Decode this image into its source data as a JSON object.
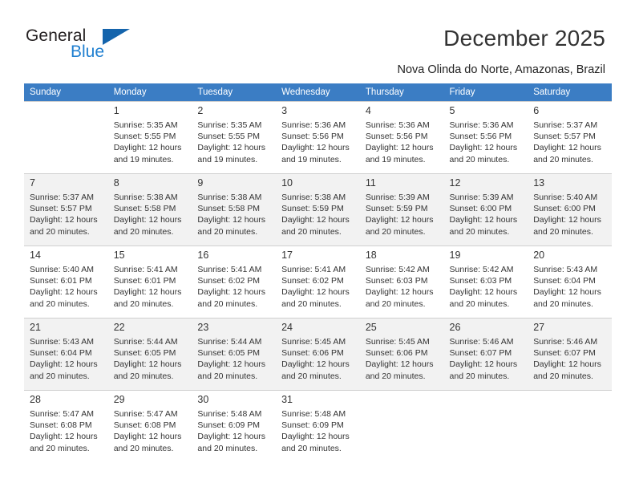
{
  "brand": {
    "name_part1": "General",
    "name_part2": "Blue",
    "accent_color": "#1f7fd0",
    "triangle_color": "#1464ac"
  },
  "header": {
    "title": "December 2025",
    "location": "Nova Olinda do Norte, Amazonas, Brazil"
  },
  "calendar": {
    "header_color": "#3b7dc4",
    "weekdays": [
      "Sunday",
      "Monday",
      "Tuesday",
      "Wednesday",
      "Thursday",
      "Friday",
      "Saturday"
    ],
    "weeks": [
      {
        "shaded": false,
        "days": [
          {
            "num": "",
            "sunrise": "",
            "sunset": "",
            "daylight1": "",
            "daylight2": ""
          },
          {
            "num": "1",
            "sunrise": "Sunrise: 5:35 AM",
            "sunset": "Sunset: 5:55 PM",
            "daylight1": "Daylight: 12 hours",
            "daylight2": "and 19 minutes."
          },
          {
            "num": "2",
            "sunrise": "Sunrise: 5:35 AM",
            "sunset": "Sunset: 5:55 PM",
            "daylight1": "Daylight: 12 hours",
            "daylight2": "and 19 minutes."
          },
          {
            "num": "3",
            "sunrise": "Sunrise: 5:36 AM",
            "sunset": "Sunset: 5:56 PM",
            "daylight1": "Daylight: 12 hours",
            "daylight2": "and 19 minutes."
          },
          {
            "num": "4",
            "sunrise": "Sunrise: 5:36 AM",
            "sunset": "Sunset: 5:56 PM",
            "daylight1": "Daylight: 12 hours",
            "daylight2": "and 19 minutes."
          },
          {
            "num": "5",
            "sunrise": "Sunrise: 5:36 AM",
            "sunset": "Sunset: 5:56 PM",
            "daylight1": "Daylight: 12 hours",
            "daylight2": "and 20 minutes."
          },
          {
            "num": "6",
            "sunrise": "Sunrise: 5:37 AM",
            "sunset": "Sunset: 5:57 PM",
            "daylight1": "Daylight: 12 hours",
            "daylight2": "and 20 minutes."
          }
        ]
      },
      {
        "shaded": true,
        "days": [
          {
            "num": "7",
            "sunrise": "Sunrise: 5:37 AM",
            "sunset": "Sunset: 5:57 PM",
            "daylight1": "Daylight: 12 hours",
            "daylight2": "and 20 minutes."
          },
          {
            "num": "8",
            "sunrise": "Sunrise: 5:38 AM",
            "sunset": "Sunset: 5:58 PM",
            "daylight1": "Daylight: 12 hours",
            "daylight2": "and 20 minutes."
          },
          {
            "num": "9",
            "sunrise": "Sunrise: 5:38 AM",
            "sunset": "Sunset: 5:58 PM",
            "daylight1": "Daylight: 12 hours",
            "daylight2": "and 20 minutes."
          },
          {
            "num": "10",
            "sunrise": "Sunrise: 5:38 AM",
            "sunset": "Sunset: 5:59 PM",
            "daylight1": "Daylight: 12 hours",
            "daylight2": "and 20 minutes."
          },
          {
            "num": "11",
            "sunrise": "Sunrise: 5:39 AM",
            "sunset": "Sunset: 5:59 PM",
            "daylight1": "Daylight: 12 hours",
            "daylight2": "and 20 minutes."
          },
          {
            "num": "12",
            "sunrise": "Sunrise: 5:39 AM",
            "sunset": "Sunset: 6:00 PM",
            "daylight1": "Daylight: 12 hours",
            "daylight2": "and 20 minutes."
          },
          {
            "num": "13",
            "sunrise": "Sunrise: 5:40 AM",
            "sunset": "Sunset: 6:00 PM",
            "daylight1": "Daylight: 12 hours",
            "daylight2": "and 20 minutes."
          }
        ]
      },
      {
        "shaded": false,
        "days": [
          {
            "num": "14",
            "sunrise": "Sunrise: 5:40 AM",
            "sunset": "Sunset: 6:01 PM",
            "daylight1": "Daylight: 12 hours",
            "daylight2": "and 20 minutes."
          },
          {
            "num": "15",
            "sunrise": "Sunrise: 5:41 AM",
            "sunset": "Sunset: 6:01 PM",
            "daylight1": "Daylight: 12 hours",
            "daylight2": "and 20 minutes."
          },
          {
            "num": "16",
            "sunrise": "Sunrise: 5:41 AM",
            "sunset": "Sunset: 6:02 PM",
            "daylight1": "Daylight: 12 hours",
            "daylight2": "and 20 minutes."
          },
          {
            "num": "17",
            "sunrise": "Sunrise: 5:41 AM",
            "sunset": "Sunset: 6:02 PM",
            "daylight1": "Daylight: 12 hours",
            "daylight2": "and 20 minutes."
          },
          {
            "num": "18",
            "sunrise": "Sunrise: 5:42 AM",
            "sunset": "Sunset: 6:03 PM",
            "daylight1": "Daylight: 12 hours",
            "daylight2": "and 20 minutes."
          },
          {
            "num": "19",
            "sunrise": "Sunrise: 5:42 AM",
            "sunset": "Sunset: 6:03 PM",
            "daylight1": "Daylight: 12 hours",
            "daylight2": "and 20 minutes."
          },
          {
            "num": "20",
            "sunrise": "Sunrise: 5:43 AM",
            "sunset": "Sunset: 6:04 PM",
            "daylight1": "Daylight: 12 hours",
            "daylight2": "and 20 minutes."
          }
        ]
      },
      {
        "shaded": true,
        "days": [
          {
            "num": "21",
            "sunrise": "Sunrise: 5:43 AM",
            "sunset": "Sunset: 6:04 PM",
            "daylight1": "Daylight: 12 hours",
            "daylight2": "and 20 minutes."
          },
          {
            "num": "22",
            "sunrise": "Sunrise: 5:44 AM",
            "sunset": "Sunset: 6:05 PM",
            "daylight1": "Daylight: 12 hours",
            "daylight2": "and 20 minutes."
          },
          {
            "num": "23",
            "sunrise": "Sunrise: 5:44 AM",
            "sunset": "Sunset: 6:05 PM",
            "daylight1": "Daylight: 12 hours",
            "daylight2": "and 20 minutes."
          },
          {
            "num": "24",
            "sunrise": "Sunrise: 5:45 AM",
            "sunset": "Sunset: 6:06 PM",
            "daylight1": "Daylight: 12 hours",
            "daylight2": "and 20 minutes."
          },
          {
            "num": "25",
            "sunrise": "Sunrise: 5:45 AM",
            "sunset": "Sunset: 6:06 PM",
            "daylight1": "Daylight: 12 hours",
            "daylight2": "and 20 minutes."
          },
          {
            "num": "26",
            "sunrise": "Sunrise: 5:46 AM",
            "sunset": "Sunset: 6:07 PM",
            "daylight1": "Daylight: 12 hours",
            "daylight2": "and 20 minutes."
          },
          {
            "num": "27",
            "sunrise": "Sunrise: 5:46 AM",
            "sunset": "Sunset: 6:07 PM",
            "daylight1": "Daylight: 12 hours",
            "daylight2": "and 20 minutes."
          }
        ]
      },
      {
        "shaded": false,
        "days": [
          {
            "num": "28",
            "sunrise": "Sunrise: 5:47 AM",
            "sunset": "Sunset: 6:08 PM",
            "daylight1": "Daylight: 12 hours",
            "daylight2": "and 20 minutes."
          },
          {
            "num": "29",
            "sunrise": "Sunrise: 5:47 AM",
            "sunset": "Sunset: 6:08 PM",
            "daylight1": "Daylight: 12 hours",
            "daylight2": "and 20 minutes."
          },
          {
            "num": "30",
            "sunrise": "Sunrise: 5:48 AM",
            "sunset": "Sunset: 6:09 PM",
            "daylight1": "Daylight: 12 hours",
            "daylight2": "and 20 minutes."
          },
          {
            "num": "31",
            "sunrise": "Sunrise: 5:48 AM",
            "sunset": "Sunset: 6:09 PM",
            "daylight1": "Daylight: 12 hours",
            "daylight2": "and 20 minutes."
          },
          {
            "num": "",
            "sunrise": "",
            "sunset": "",
            "daylight1": "",
            "daylight2": ""
          },
          {
            "num": "",
            "sunrise": "",
            "sunset": "",
            "daylight1": "",
            "daylight2": ""
          },
          {
            "num": "",
            "sunrise": "",
            "sunset": "",
            "daylight1": "",
            "daylight2": ""
          }
        ]
      }
    ]
  }
}
